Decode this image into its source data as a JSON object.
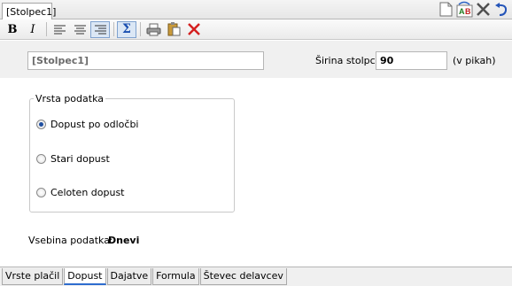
{
  "window": {
    "tab_title": "[Stolpec1]"
  },
  "top_icons": [
    "new-document-icon",
    "spellcheck-icon",
    "close-icon",
    "undo-icon"
  ],
  "toolbar": {
    "bold_label": "B",
    "italic_label": "I",
    "icons": [
      "align-left-icon",
      "align-center-icon",
      "align-right-icon",
      "sum-icon",
      "print-icon",
      "paste-icon",
      "delete-icon"
    ]
  },
  "column": {
    "name": "[Stolpec1]",
    "width_label": "Širina stolpca",
    "width_value": "90",
    "units": "(v pikah)"
  },
  "data_type": {
    "legend": "Vrsta podatka",
    "options": [
      {
        "label": "Dopust po odločbi",
        "checked": true
      },
      {
        "label": "Stari dopust",
        "checked": false
      },
      {
        "label": "Celoten dopust",
        "checked": false
      }
    ]
  },
  "data_content": {
    "label": "Vsebina podatka:",
    "value": "Dnevi"
  },
  "bottom_tabs": [
    {
      "label": "Vrste plačil",
      "active": false
    },
    {
      "label": "Dopust",
      "active": true
    },
    {
      "label": "Dajatve",
      "active": false
    },
    {
      "label": "Formula",
      "active": false
    },
    {
      "label": "Števec delavcev",
      "active": false
    }
  ],
  "colors": {
    "accent": "#2d6ccf",
    "delete": "#d42020",
    "sum": "#1a4fb0"
  }
}
